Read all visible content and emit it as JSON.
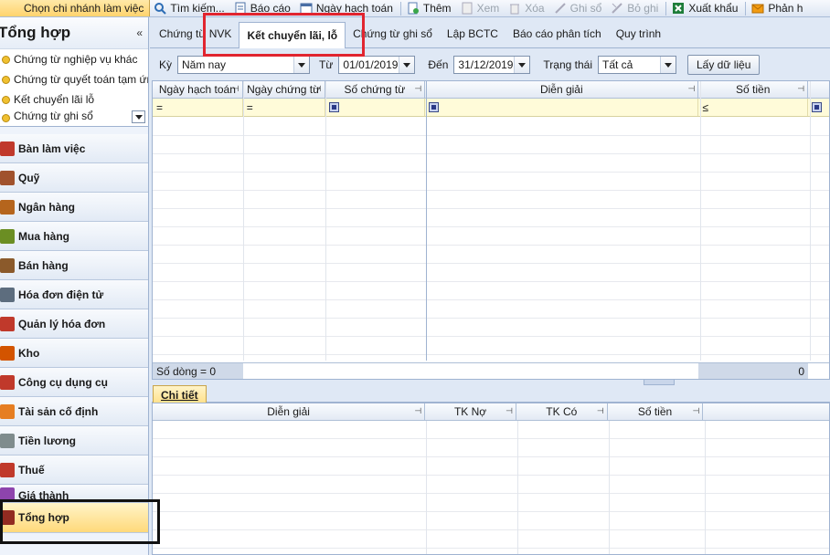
{
  "toolbar": {
    "branch": "Chọn chi nhánh làm việc",
    "items": [
      {
        "label": "Tìm kiếm...",
        "icon": "search-icon",
        "disabled": false
      },
      {
        "label": "Báo cáo",
        "icon": "report-icon",
        "disabled": false
      },
      {
        "label": "Ngày hạch toán",
        "icon": "calendar-icon",
        "disabled": false
      },
      {
        "label": "Thêm",
        "icon": "add-doc-icon",
        "disabled": false
      },
      {
        "label": "Xem",
        "icon": "view-icon",
        "disabled": true
      },
      {
        "label": "Xóa",
        "icon": "delete-icon",
        "disabled": true
      },
      {
        "label": "Ghi sổ",
        "icon": "post-icon",
        "disabled": true
      },
      {
        "label": "Bỏ ghi",
        "icon": "unpost-icon",
        "disabled": true
      },
      {
        "label": "Xuất khẩu",
        "icon": "excel-icon",
        "disabled": false
      },
      {
        "label": "Phản h",
        "icon": "mail-icon",
        "disabled": false
      }
    ]
  },
  "sidebar": {
    "title": "Tổng hợp",
    "collapse_glyph": "«",
    "subitems": [
      {
        "label": "Chứng từ nghiệp vụ khác"
      },
      {
        "label": "Chứng từ quyết toán tạm ứn..."
      },
      {
        "label": "Kết chuyển lãi lỗ"
      },
      {
        "label": "Chứng từ ghi sổ"
      }
    ],
    "modules": [
      {
        "label": "Bàn làm việc",
        "icon": "desk-icon",
        "color": "#c0392b"
      },
      {
        "label": "Quỹ",
        "icon": "cash-icon",
        "color": "#a0522d"
      },
      {
        "label": "Ngân hàng",
        "icon": "bank-icon",
        "color": "#b5651d"
      },
      {
        "label": "Mua hàng",
        "icon": "purchase-icon",
        "color": "#6b8e23"
      },
      {
        "label": "Bán hàng",
        "icon": "sales-icon",
        "color": "#8b5a2b"
      },
      {
        "label": "Hóa đơn điện tử",
        "icon": "einvoice-icon",
        "color": "#5d6d7e"
      },
      {
        "label": "Quản lý hóa đơn",
        "icon": "invoice-icon",
        "color": "#c0392b"
      },
      {
        "label": "Kho",
        "icon": "warehouse-icon",
        "color": "#d35400"
      },
      {
        "label": "Công cụ dụng cụ",
        "icon": "tools-icon",
        "color": "#c0392b"
      },
      {
        "label": "Tài sản cố định",
        "icon": "asset-icon",
        "color": "#e67e22"
      },
      {
        "label": "Tiền lương",
        "icon": "payroll-icon",
        "color": "#7f8c8d"
      },
      {
        "label": "Thuế",
        "icon": "tax-icon",
        "color": "#c0392b"
      },
      {
        "label": "Giá thành",
        "icon": "cost-icon",
        "color": "#8e44ad"
      },
      {
        "label": "Tổng hợp",
        "icon": "ledger-icon",
        "color": "#922b21"
      }
    ]
  },
  "tabs": [
    {
      "label": "Chứng từ NVK"
    },
    {
      "label": "Kết chuyển lãi, lỗ",
      "active": true
    },
    {
      "label": "Chứng từ ghi sổ"
    },
    {
      "label": "Lập BCTC"
    },
    {
      "label": "Báo cáo phân tích"
    },
    {
      "label": "Quy trình"
    }
  ],
  "filters": {
    "period_label": "Kỳ",
    "period_value": "Năm nay",
    "from_label": "Từ",
    "from_value": "01/01/2019",
    "to_label": "Đến",
    "to_value": "31/12/2019",
    "status_label": "Trạng thái",
    "status_value": "Tất cả",
    "fetch_button": "Lấy dữ liệu"
  },
  "grid": {
    "columns": [
      "Ngày hạch toán",
      "Ngày chứng từ",
      "Số chứng từ",
      "Diễn giải",
      "Số tiền"
    ],
    "filter_ops": [
      "=",
      "=",
      "",
      "",
      "≤"
    ],
    "footer_count": "Số dòng = 0",
    "footer_total": "0"
  },
  "detail": {
    "tab": "Chi tiết",
    "columns": [
      "Diễn giải",
      "TK Nợ",
      "TK Có",
      "Số tiền"
    ]
  }
}
